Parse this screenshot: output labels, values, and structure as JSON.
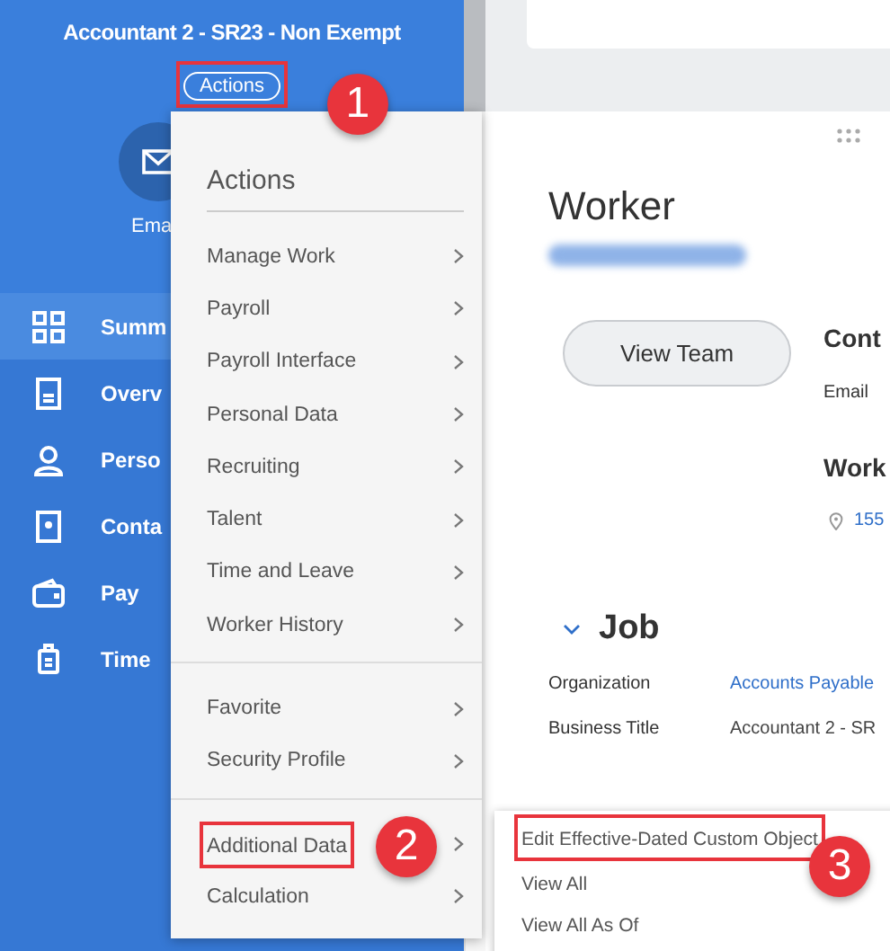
{
  "sidebar": {
    "title": "Accountant 2 - SR23 - Non Exempt",
    "actions_button": {
      "label": "Actions",
      "callout": "1"
    },
    "quick_action": {
      "label": "Ema"
    },
    "items": [
      {
        "label": "Summ",
        "selected": true
      },
      {
        "label": "Overv",
        "selected": false
      },
      {
        "label": "Perso",
        "selected": false
      },
      {
        "label": "Conta",
        "selected": false
      },
      {
        "label": "Pay",
        "selected": false
      },
      {
        "label": "Time",
        "selected": false
      }
    ]
  },
  "menu": {
    "title": "Actions",
    "groups": [
      [
        {
          "label": "Manage Work"
        },
        {
          "label": "Payroll"
        },
        {
          "label": "Payroll Interface"
        },
        {
          "label": "Personal Data"
        },
        {
          "label": "Recruiting"
        },
        {
          "label": "Talent"
        },
        {
          "label": "Time and Leave"
        },
        {
          "label": "Worker History"
        }
      ],
      [
        {
          "label": "Favorite"
        },
        {
          "label": "Security Profile"
        }
      ],
      [
        {
          "label": "Additional Data",
          "callout": "2"
        },
        {
          "label": "Calculation"
        }
      ]
    ]
  },
  "submenu": {
    "items": [
      {
        "label": "Edit Effective-Dated Custom Object",
        "callout": "3"
      },
      {
        "label": "View All"
      },
      {
        "label": "View All As Of"
      }
    ]
  },
  "main": {
    "heading": "Worker",
    "view_team": "View Team",
    "contact": {
      "heading": "Cont",
      "email_label": "Email",
      "work_heading": "Work",
      "address": "155"
    },
    "job": {
      "heading": "Job",
      "fields": [
        {
          "label": "Organization",
          "value": "Accounts Payable",
          "link": true
        },
        {
          "label": "Business Title",
          "value": "Accountant 2 - SR",
          "link": false
        }
      ]
    }
  }
}
